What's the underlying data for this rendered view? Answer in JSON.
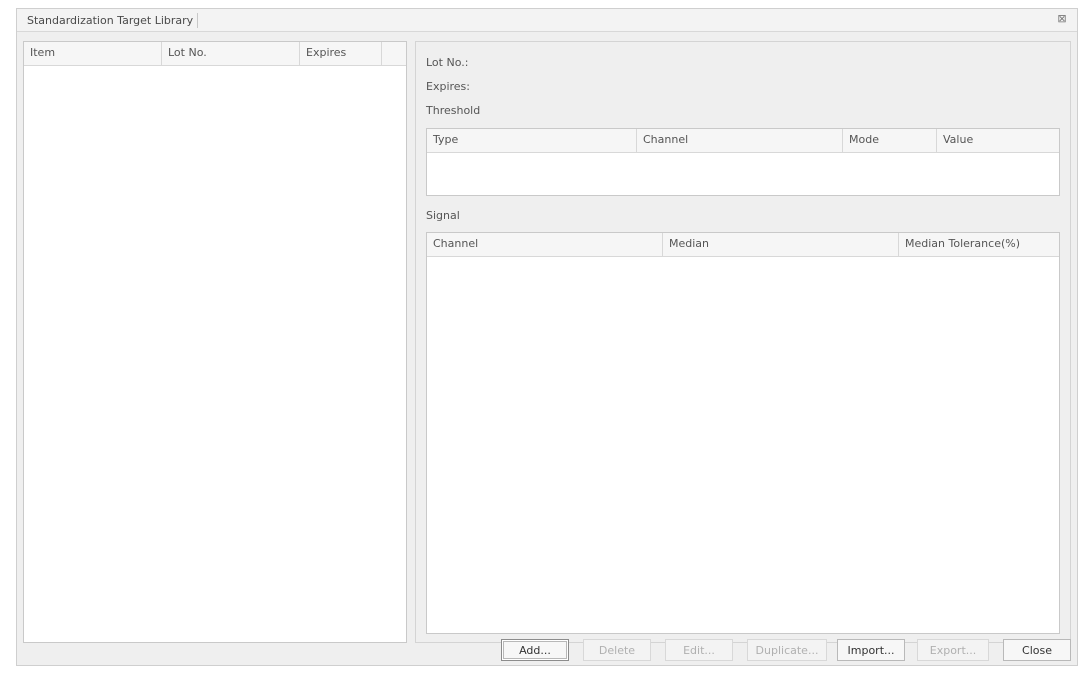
{
  "window": {
    "title": "Standardization Target Library",
    "close_glyph": "⊠"
  },
  "left_grid": {
    "columns": [
      "Item",
      "Lot No.",
      "Expires",
      ""
    ]
  },
  "details": {
    "lot_no_label": "Lot No.:",
    "expires_label": "Expires:",
    "threshold_label": "Threshold",
    "signal_label": "Signal"
  },
  "threshold_grid": {
    "columns": [
      "Type",
      "Channel",
      "Mode",
      "Value"
    ]
  },
  "signal_grid": {
    "columns": [
      "Channel",
      "Median",
      "Median Tolerance(%)"
    ]
  },
  "buttons": {
    "add": "Add...",
    "delete": "Delete",
    "edit": "Edit...",
    "duplicate": "Duplicate...",
    "import": "Import...",
    "export": "Export...",
    "close": "Close"
  }
}
